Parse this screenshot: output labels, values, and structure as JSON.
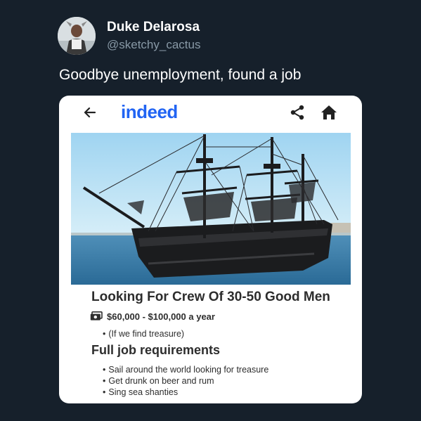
{
  "tweet": {
    "author": {
      "display_name": "Duke Delarosa",
      "handle": "@sketchy_cactus"
    },
    "text": "Goodbye unemployment, found a job"
  },
  "job_card": {
    "brand": "indeed",
    "icons": [
      "back-arrow-icon",
      "share-icon",
      "home-icon",
      "money-icon"
    ],
    "brand_color": "#2164f3",
    "title": "Looking For Crew Of 30-50 Good Men",
    "salary": "$60,000 - $100,000 a year",
    "salary_note": "(If we find treasure)",
    "requirements_heading": "Full job requirements",
    "requirements": [
      "Sail around the world looking for treasure",
      "Get drunk on beer and rum",
      "Sing sea shanties"
    ]
  }
}
